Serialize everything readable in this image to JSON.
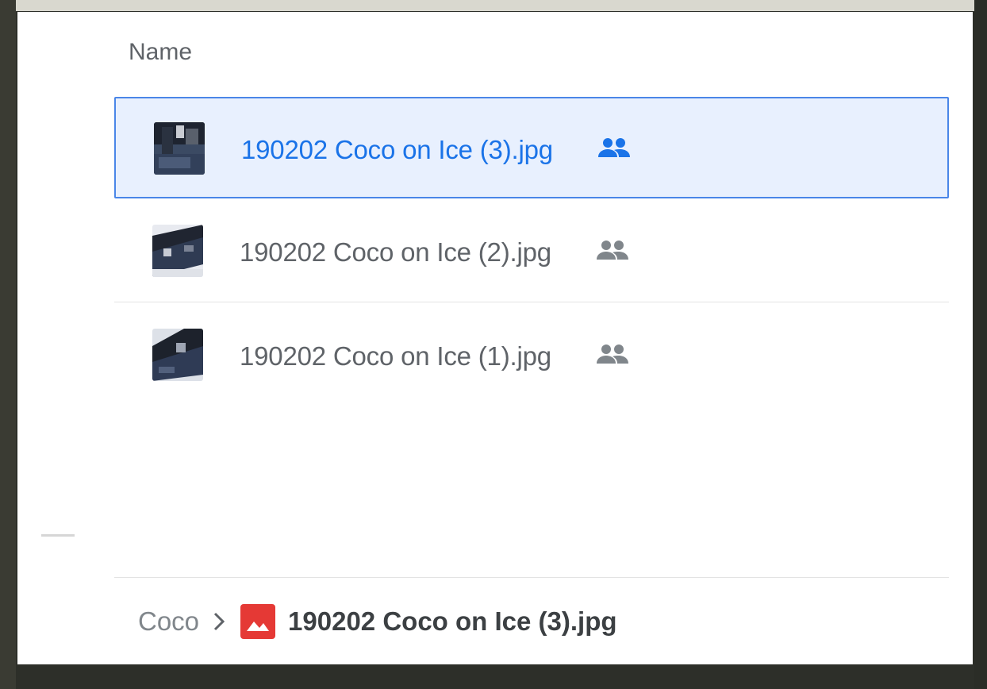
{
  "list_header": {
    "name_label": "Name"
  },
  "files": [
    {
      "name": "190202 Coco on Ice (3).jpg",
      "selected": true,
      "shared_icon": "people-icon",
      "thumbnail_icon": "photo-thumbnail"
    },
    {
      "name": "190202 Coco on Ice (2).jpg",
      "selected": false,
      "shared_icon": "people-icon",
      "thumbnail_icon": "photo-thumbnail"
    },
    {
      "name": "190202 Coco on Ice (1).jpg",
      "selected": false,
      "shared_icon": "people-icon",
      "thumbnail_icon": "photo-thumbnail"
    }
  ],
  "breadcrumb": {
    "parent": "Coco",
    "separator_icon": "chevron-right-icon",
    "file_type_icon": "image-file-icon",
    "current": "190202 Coco on Ice (3).jpg"
  },
  "colors": {
    "selected_text": "#1a73e8",
    "selected_background": "#e8f0fe",
    "selected_border": "#4a86e8",
    "default_text": "#5f6368",
    "image_icon_red": "#e53935"
  }
}
